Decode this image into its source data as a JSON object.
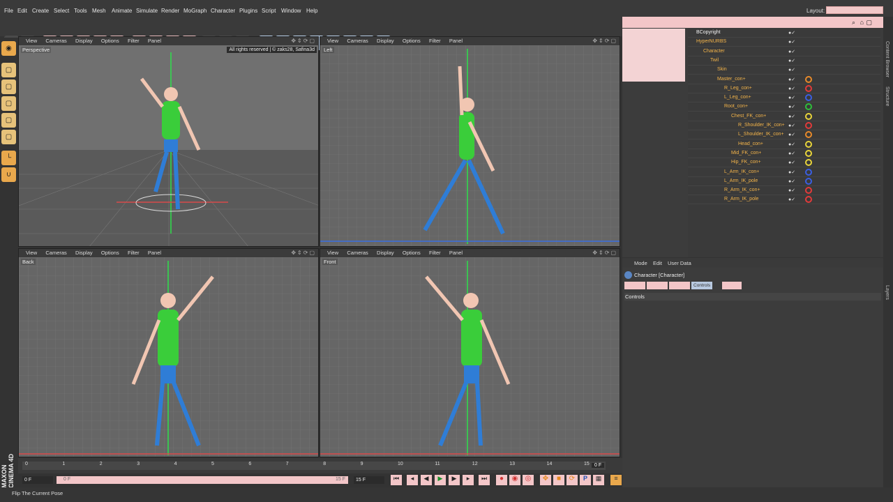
{
  "menubar": {
    "items": [
      "File",
      "Edit",
      "Create",
      "Select",
      "Tools",
      "Mesh",
      "Animate",
      "Simulate",
      "Render",
      "MoGraph",
      "Character",
      "Plugins",
      "Script",
      "Window",
      "Help"
    ],
    "layout_label": "Layout:"
  },
  "viewports": {
    "menu": [
      "View",
      "Cameras",
      "Display",
      "Options",
      "Filter",
      "Panel"
    ],
    "names": [
      "Perspective",
      "Left",
      "Back",
      "Front"
    ],
    "copyright": "All rights reserved | © zaks28, Safina3d"
  },
  "timeline": {
    "ticks": [
      "0",
      "1",
      "2",
      "3",
      "4",
      "5",
      "6",
      "7",
      "8",
      "9",
      "10",
      "11",
      "12",
      "13",
      "14",
      "15"
    ],
    "end_field": "0 F",
    "start_field": "0 F",
    "range_start": "0 F",
    "range_end": "15 F",
    "max_field": "15 F"
  },
  "status": {
    "text": "Flip The Current Pose"
  },
  "brand": {
    "text": "MAXON CINEMA 4D"
  },
  "object_manager": {
    "rows": [
      {
        "name": "BCopyright",
        "indent": 12,
        "white": true,
        "tag": ""
      },
      {
        "name": "HyperNURBS",
        "indent": 12,
        "white": false,
        "tag": ""
      },
      {
        "name": "Character",
        "indent": 22,
        "white": false,
        "tag": ""
      },
      {
        "name": "Twil",
        "indent": 32,
        "white": false,
        "tag": ""
      },
      {
        "name": "Skin",
        "indent": 42,
        "white": false,
        "tag": ""
      },
      {
        "name": "Master_con+",
        "indent": 42,
        "white": false,
        "tag": "orange"
      },
      {
        "name": "R_Leg_con+",
        "indent": 52,
        "white": false,
        "tag": "red"
      },
      {
        "name": "L_Leg_con+",
        "indent": 52,
        "white": false,
        "tag": "blue"
      },
      {
        "name": "Root_con+",
        "indent": 52,
        "white": false,
        "tag": "green"
      },
      {
        "name": "Chest_FK_con+",
        "indent": 62,
        "white": false,
        "tag": "yellow"
      },
      {
        "name": "R_Shoulder_IK_con+",
        "indent": 72,
        "white": false,
        "tag": "red"
      },
      {
        "name": "L_Shoulder_IK_con+",
        "indent": 72,
        "white": false,
        "tag": "orange"
      },
      {
        "name": "Head_con+",
        "indent": 72,
        "white": false,
        "tag": "yellow"
      },
      {
        "name": "Mid_FK_con+",
        "indent": 62,
        "white": false,
        "tag": "yellow"
      },
      {
        "name": "Hip_FK_con+",
        "indent": 62,
        "white": false,
        "tag": "yellow"
      },
      {
        "name": "L_Arm_IK_con+",
        "indent": 52,
        "white": false,
        "tag": "blue"
      },
      {
        "name": "L_Arm_IK_pole",
        "indent": 52,
        "white": false,
        "tag": "blue"
      },
      {
        "name": "R_Arm_IK_con+",
        "indent": 52,
        "white": false,
        "tag": "red"
      },
      {
        "name": "R_Arm_IK_pole",
        "indent": 52,
        "white": false,
        "tag": "red"
      }
    ]
  },
  "attribute_manager": {
    "menu": [
      "Mode",
      "Edit",
      "User Data"
    ],
    "title": "Character [Character]",
    "active_tab": "Controls",
    "section": "Controls"
  },
  "right_strip": {
    "labels": [
      "Content Browser",
      "Structure",
      "Layers"
    ]
  },
  "colors": {
    "accent_pink": "#f3c6c8",
    "viewport_bg": "#6b6b6b",
    "panel_bg": "#3c3c3c"
  }
}
